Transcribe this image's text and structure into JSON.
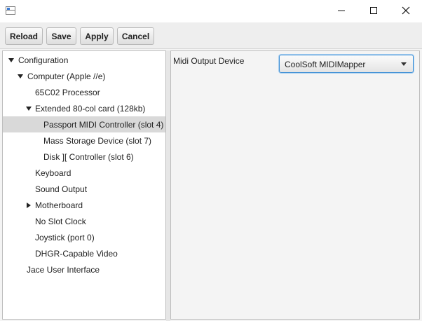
{
  "window": {
    "icon": "app-window-icon",
    "controls": [
      "minimize-icon",
      "maximize-icon",
      "close-icon"
    ]
  },
  "toolbar": {
    "reload_label": "Reload",
    "save_label": "Save",
    "apply_label": "Apply",
    "cancel_label": "Cancel"
  },
  "tree": {
    "items": [
      {
        "label": "Configuration",
        "expanded": true
      },
      {
        "label": "Computer (Apple //e)",
        "expanded": true
      },
      {
        "label": "65C02 Processor"
      },
      {
        "label": "Extended 80-col card (128kb)",
        "expanded": true
      },
      {
        "label": "Passport MIDI Controller (slot 4)",
        "selected": true
      },
      {
        "label": "Mass Storage Device (slot 7)"
      },
      {
        "label": "Disk ][ Controller (slot 6)"
      },
      {
        "label": "Keyboard"
      },
      {
        "label": "Sound Output"
      },
      {
        "label": "Motherboard",
        "expanded": false
      },
      {
        "label": "No Slot Clock"
      },
      {
        "label": "Joystick (port 0)"
      },
      {
        "label": "DHGR-Capable Video"
      },
      {
        "label": "Jace User Interface"
      }
    ]
  },
  "detail": {
    "field_label": "Midi Output Device",
    "device_value": "CoolSoft MIDIMapper"
  },
  "colors": {
    "selection": "#d9d9d9",
    "focus_border": "#3d8fd6"
  }
}
